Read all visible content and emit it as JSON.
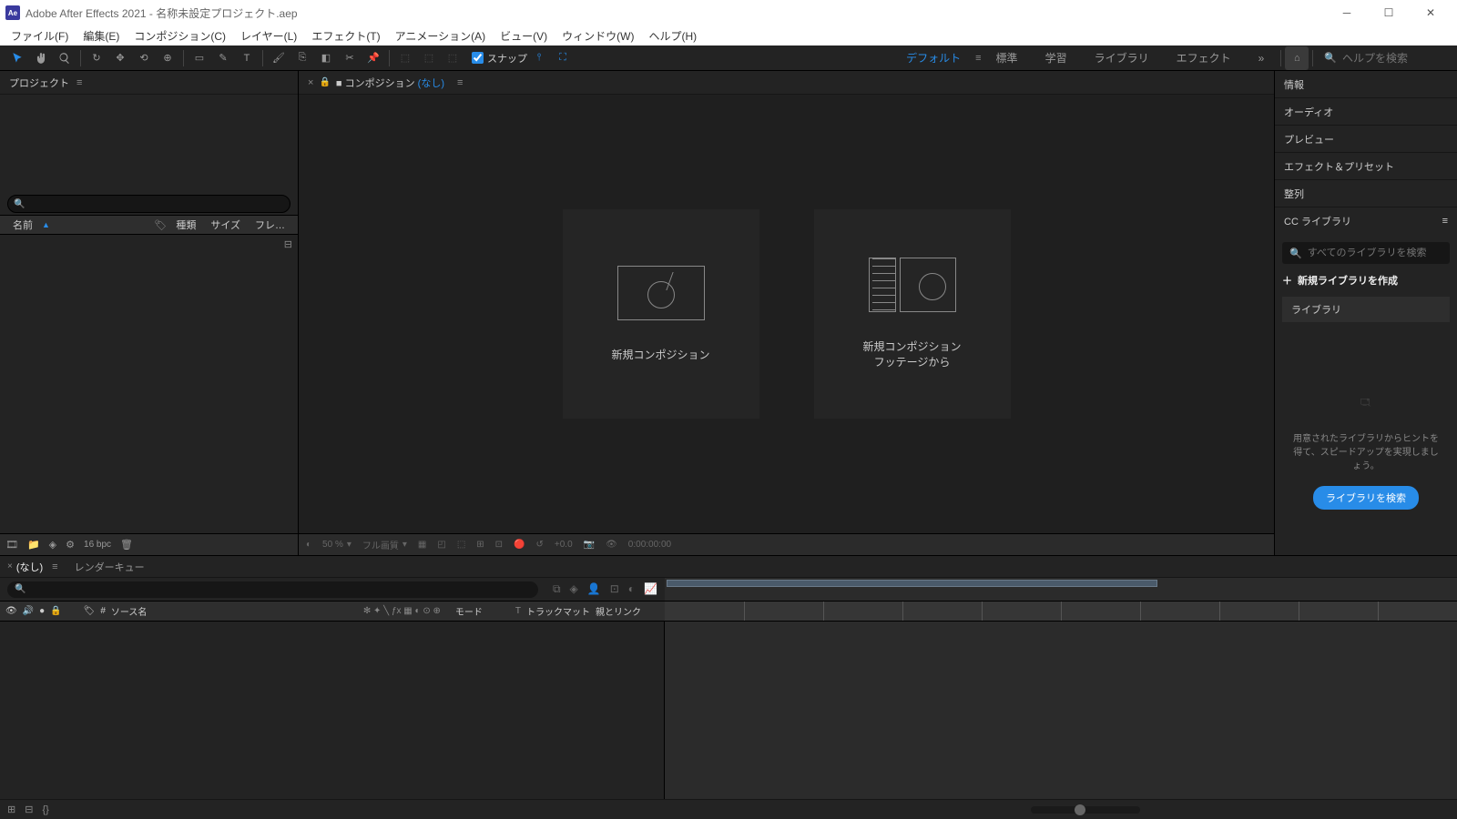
{
  "title": "Adobe After Effects 2021 - 名称未設定プロジェクト.aep",
  "menu": [
    "ファイル(F)",
    "編集(E)",
    "コンポジション(C)",
    "レイヤー(L)",
    "エフェクト(T)",
    "アニメーション(A)",
    "ビュー(V)",
    "ウィンドウ(W)",
    "ヘルプ(H)"
  ],
  "snap_label": "スナップ",
  "workspaces": [
    "デフォルト",
    "標準",
    "学習",
    "ライブラリ",
    "エフェクト"
  ],
  "search_placeholder": "ヘルプを検索",
  "project": {
    "title": "プロジェクト",
    "cols": {
      "name": "名前",
      "type": "種類",
      "size": "サイズ",
      "fr": "フレ…"
    },
    "bpc": "16 bpc"
  },
  "comp": {
    "prefix": "コンポジション",
    "none": "(なし)",
    "card1": "新規コンポジション",
    "card2a": "新規コンポジション",
    "card2b": "フッテージから",
    "mag": "50 %",
    "res": "フル画質",
    "exposure": "+0.0",
    "time": "0:00:00:00"
  },
  "panels": [
    "情報",
    "オーディオ",
    "プレビュー",
    "エフェクト＆プリセット",
    "整列"
  ],
  "cclib": {
    "title": "CC ライブラリ",
    "search_ph": "すべてのライブラリを検索",
    "new": "新規ライブラリを作成",
    "tab": "ライブラリ",
    "empty": "用意されたライブラリからヒントを得て、スピードアップを実現しましょう。",
    "btn": "ライブラリを検索"
  },
  "timeline": {
    "none": "(なし)",
    "render": "レンダーキュー",
    "cols": {
      "src": "ソース名",
      "mode": "モード",
      "track": "トラックマット",
      "parent": "親とリンク"
    }
  }
}
